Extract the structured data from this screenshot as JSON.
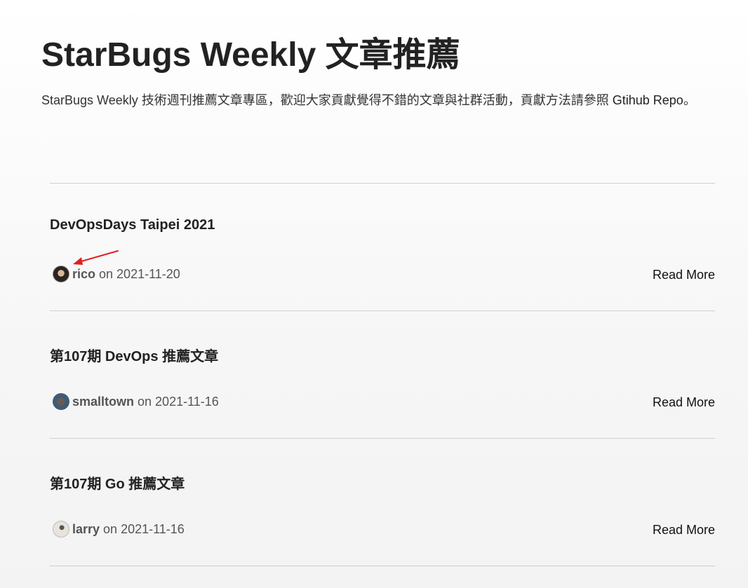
{
  "header": {
    "title": "StarBugs Weekly 文章推薦",
    "intro_text": "StarBugs Weekly 技術週刊推薦文章專區，歡迎大家貢獻覺得不錯的文章與社群活動，貢獻方法請參照 ",
    "intro_link": "Gtihub Repo",
    "intro_suffix": "。"
  },
  "posts": [
    {
      "title": "DevOpsDays Taipei 2021",
      "author": "rico",
      "date": "2021-11-20",
      "read_more": "Read More",
      "avatar": "avatar-photo"
    },
    {
      "title": "第107期 DevOps 推薦文章",
      "author": "smalltown",
      "date": "2021-11-16",
      "read_more": "Read More",
      "avatar": "avatar-photo"
    },
    {
      "title": "第107期 Go 推薦文章",
      "author": "larry",
      "date": "2021-11-16",
      "read_more": "Read More",
      "avatar": "avatar-photo"
    }
  ],
  "meta": {
    "on_word": "on"
  },
  "annotation": {
    "arrow_color": "#e02020",
    "icon": "red-arrow-annotation"
  }
}
